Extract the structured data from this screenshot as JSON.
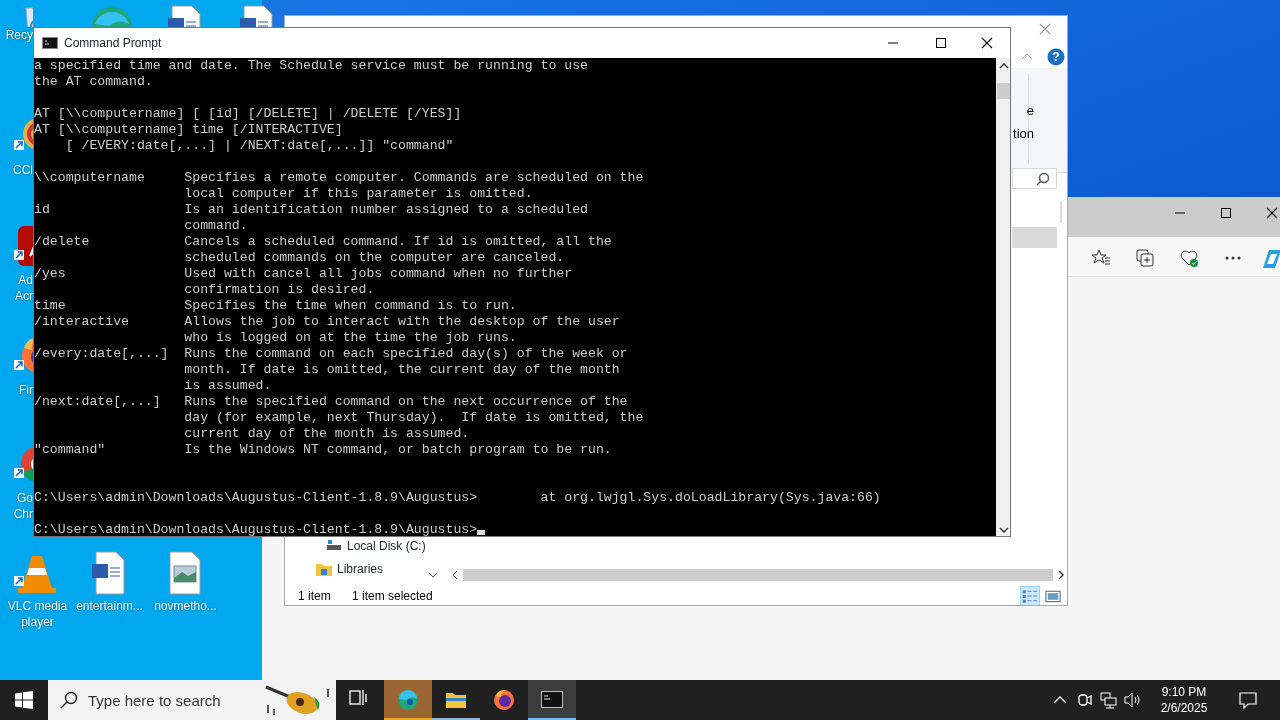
{
  "desktop": {
    "icons": [
      {
        "kind": "recycle-bin",
        "label_lines": [
          "Recy"
        ]
      },
      {
        "kind": "edge"
      },
      {
        "kind": "word-doc"
      },
      {
        "kind": "word-doc"
      },
      {
        "kind": "ccleaner",
        "label_lines": [
          "CCl"
        ]
      },
      {
        "kind": "acrobat",
        "label_lines": [
          "Ad",
          "Acr"
        ]
      },
      {
        "kind": "firefox",
        "label_lines": [
          "Fir"
        ]
      },
      {
        "kind": "chrome",
        "label_lines": [
          "Go",
          "Chr"
        ]
      },
      {
        "kind": "vlc",
        "label_lines": [
          "VLC media",
          "player"
        ]
      },
      {
        "kind": "word-doc",
        "label_lines": [
          "entertainm..."
        ]
      },
      {
        "kind": "image-file",
        "label_lines": [
          "novmetho..."
        ]
      }
    ]
  },
  "edge_window": {
    "toolbar": [
      {
        "kind": "favorites"
      },
      {
        "kind": "collections"
      },
      {
        "kind": "health"
      },
      {
        "kind": "more"
      },
      {
        "kind": "copilot"
      }
    ]
  },
  "explorer": {
    "help_label": "?",
    "ribbon_label_lines": [
      "e",
      "tion"
    ],
    "nav_items": [
      {
        "kind": "drive",
        "label": "Local Disk (C:)"
      },
      {
        "kind": "library",
        "label": "Libraries"
      }
    ],
    "status": [
      "1 item",
      "1 item selected"
    ],
    "views": [
      {
        "kind": "details",
        "selected": true
      },
      {
        "kind": "large-icons",
        "selected": false
      }
    ]
  },
  "command_prompt": {
    "title": "Command Prompt",
    "blocks": [
      {
        "kind": "output",
        "cursor": false,
        "lines": [
          "a specified time and date. The Schedule service must be running to use",
          "the AT command."
        ]
      },
      {
        "kind": "output",
        "cursor": false,
        "lines": [
          "AT [\\\\computername] [ [id] [/DELETE] | /DELETE [/YES]]",
          "AT [\\\\computername] time [/INTERACTIVE]",
          "    [ /EVERY:date[,...] | /NEXT:date[,...]] \"command\""
        ]
      },
      {
        "kind": "output",
        "cursor": false,
        "lines": [
          "\\\\computername     Specifies a remote computer. Commands are scheduled on the",
          "                   local computer if this parameter is omitted.",
          "id                 Is an identification number assigned to a scheduled",
          "                   command.",
          "/delete            Cancels a scheduled command. If id is omitted, all the",
          "                   scheduled commands on the computer are canceled.",
          "/yes               Used with cancel all jobs command when no further",
          "                   confirmation is desired.",
          "time               Specifies the time when command is to run.",
          "/interactive       Allows the job to interact with the desktop of the user",
          "                   who is logged on at the time the job runs.",
          "/every:date[,...]  Runs the command on each specified day(s) of the week or",
          "                   month. If date is omitted, the current day of the month",
          "                   is assumed.",
          "/next:date[,...]   Runs the specified command on the next occurrence of the",
          "                   day (for example, next Thursday).  If date is omitted, the",
          "                   current day of the month is assumed.",
          "\"command\"          Is the Windows NT command, or batch program to be run."
        ]
      },
      {
        "kind": "prompt",
        "cursor": false,
        "lines": [
          "C:\\Users\\admin\\Downloads\\Augustus-Client-1.8.9\\Augustus>        at org.lwjgl.Sys.doLoadLibrary(Sys.java:66)"
        ]
      },
      {
        "kind": "prompt",
        "cursor": true,
        "lines": [
          "C:\\Users\\admin\\Downloads\\Augustus-Client-1.8.9\\Augustus>"
        ]
      }
    ]
  },
  "taskbar": {
    "search_placeholder": "Type here to search",
    "apps": [
      {
        "kind": "edge",
        "running": true,
        "attention": true,
        "selected": false
      },
      {
        "kind": "explorer",
        "running": true,
        "attention": false,
        "selected": false
      },
      {
        "kind": "firefox",
        "running": false,
        "attention": false,
        "selected": false
      },
      {
        "kind": "terminal",
        "running": true,
        "attention": false,
        "selected": true
      }
    ],
    "clock": {
      "time": "9:10 PM",
      "date": "2/6/2025"
    }
  }
}
